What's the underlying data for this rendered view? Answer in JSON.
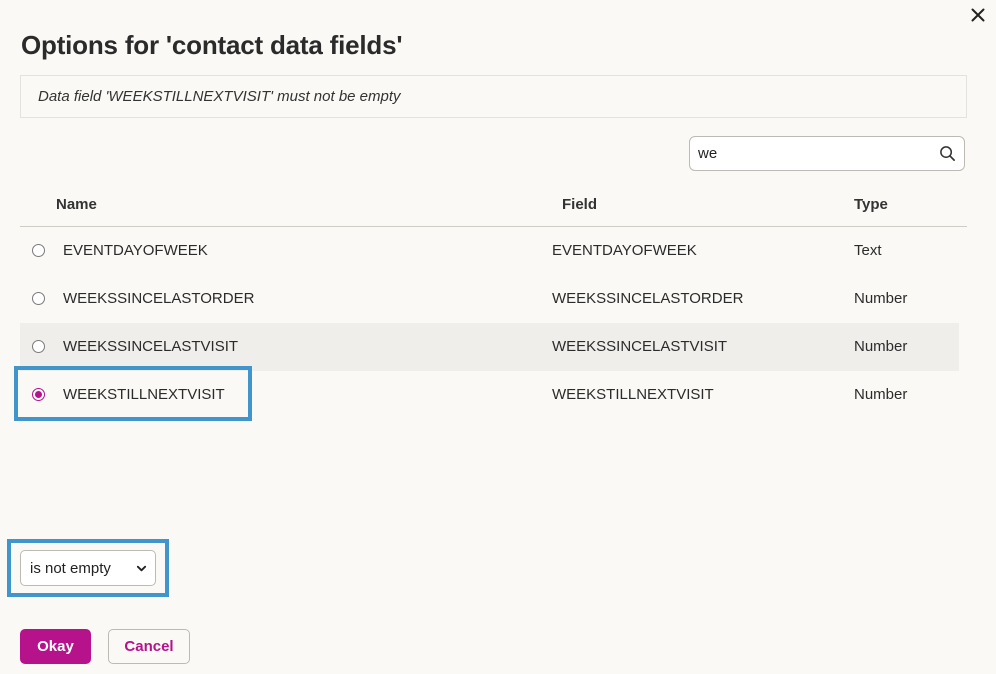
{
  "dialog": {
    "title": "Options for 'contact data fields'",
    "message": "Data field 'WEEKSTILLNEXTVISIT' must not be empty"
  },
  "search": {
    "value": "we",
    "placeholder": ""
  },
  "table": {
    "headers": {
      "name": "Name",
      "field": "Field",
      "type": "Type"
    },
    "rows": [
      {
        "name": "EVENTDAYOFWEEK",
        "field": "EVENTDAYOFWEEK",
        "type": "Text",
        "selected": false
      },
      {
        "name": "WEEKSSINCELASTORDER",
        "field": "WEEKSSINCELASTORDER",
        "type": "Number",
        "selected": false
      },
      {
        "name": "WEEKSSINCELASTVISIT",
        "field": "WEEKSSINCELASTVISIT",
        "type": "Number",
        "selected": false,
        "hovered": true
      },
      {
        "name": "WEEKSTILLNEXTVISIT",
        "field": "WEEKSTILLNEXTVISIT",
        "type": "Number",
        "selected": true
      }
    ]
  },
  "condition": {
    "selected": "is not empty"
  },
  "buttons": {
    "okay": "Okay",
    "cancel": "Cancel"
  },
  "colors": {
    "accent": "#b5128b",
    "highlight": "#3f95cc",
    "background": "#faf9f5"
  },
  "icons": {
    "close": "close-icon",
    "search": "search-icon",
    "chevron": "chevron-down-icon"
  }
}
